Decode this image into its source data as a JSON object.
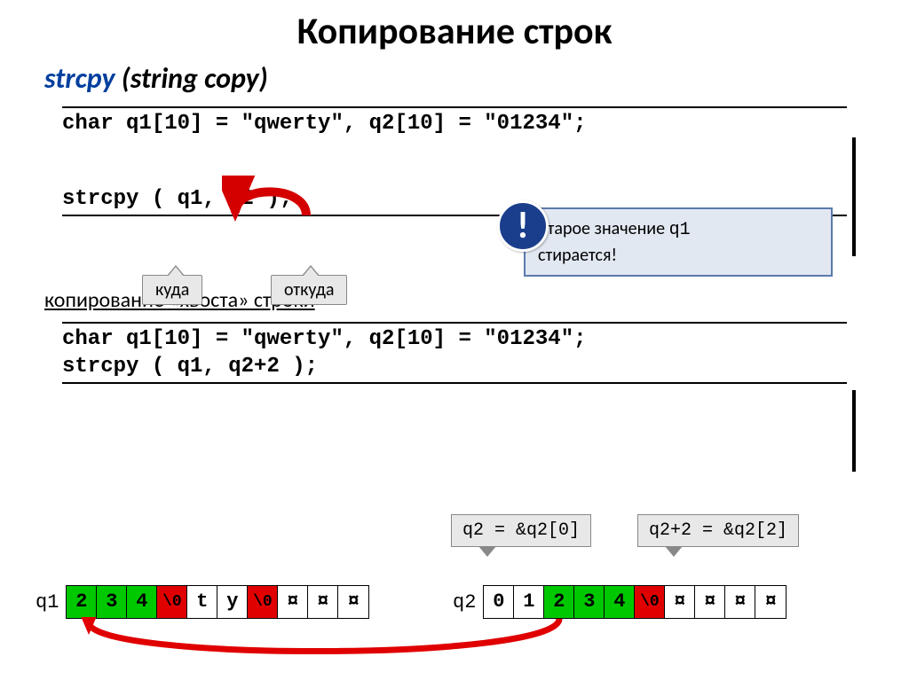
{
  "title": "Копирование строк",
  "subtitle": {
    "func": "strcpy",
    "desc": " (string copy)"
  },
  "code1": {
    "decl": "char q1[10] = \"qwerty\", q2[10] = \"01234\";",
    "call": "strcpy ( q1, q2 );"
  },
  "tags": {
    "dest": "куда",
    "src": "откуда"
  },
  "info": {
    "line1_a": "Старое значение ",
    "line1_b": "q1",
    "line2": "стирается!",
    "mark": "!"
  },
  "section_sub": "копирование «хвоста» строки",
  "code2": {
    "decl": "char q1[10] = \"qwerty\", q2[10] = \"01234\";",
    "call": "strcpy ( q1, q2+2 );"
  },
  "addr": {
    "left": "q2 = &q2[0]",
    "right": "q2+2 = &q2[2]"
  },
  "mem": {
    "q1_label": "q1",
    "q1": [
      {
        "v": "2",
        "c": "green"
      },
      {
        "v": "3",
        "c": "green"
      },
      {
        "v": "4",
        "c": "green"
      },
      {
        "v": "\\0",
        "c": "red"
      },
      {
        "v": "t",
        "c": "white"
      },
      {
        "v": "y",
        "c": "white"
      },
      {
        "v": "\\0",
        "c": "red"
      },
      {
        "v": "¤",
        "c": "white"
      },
      {
        "v": "¤",
        "c": "white"
      },
      {
        "v": "¤",
        "c": "white"
      }
    ],
    "q2_label": "q2",
    "q2": [
      {
        "v": "0",
        "c": "white"
      },
      {
        "v": "1",
        "c": "white"
      },
      {
        "v": "2",
        "c": "green"
      },
      {
        "v": "3",
        "c": "green"
      },
      {
        "v": "4",
        "c": "green"
      },
      {
        "v": "\\0",
        "c": "red"
      },
      {
        "v": "¤",
        "c": "white"
      },
      {
        "v": "¤",
        "c": "white"
      },
      {
        "v": "¤",
        "c": "white"
      },
      {
        "v": "¤",
        "c": "white"
      }
    ]
  }
}
